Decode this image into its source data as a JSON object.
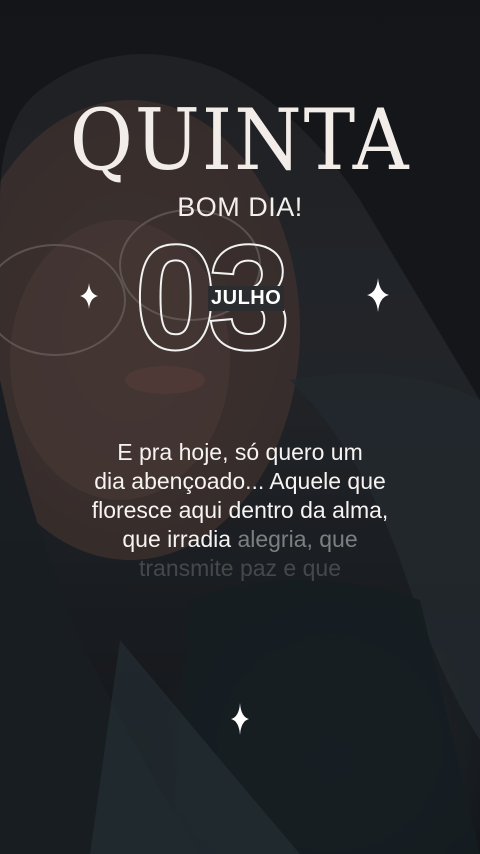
{
  "header": {
    "weekday": "QUINTA",
    "greeting": "BOM DIA!"
  },
  "date": {
    "day": "03",
    "month": "JULHO"
  },
  "message": {
    "line1": "E pra hoje, só quero um",
    "line2": "dia abençoado... Aquele que",
    "line3": "floresce aqui dentro da alma,",
    "line4_a": "que irradia ",
    "line4_b": "alegria, que",
    "line5": "transmite paz e que"
  },
  "icons": [
    "sparkle-icon"
  ],
  "colors": {
    "text": "#f2ede9",
    "background": "#25272b"
  }
}
